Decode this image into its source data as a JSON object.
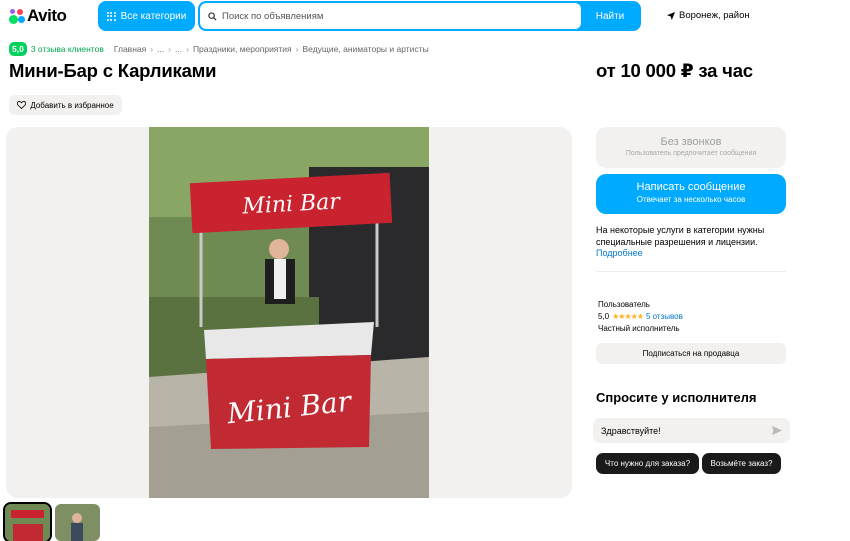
{
  "header": {
    "logo_text": "Avito",
    "categories_label": "Все категории",
    "search_placeholder": "Поиск по объявлениям",
    "search_button": "Найти",
    "location": "Воронеж, район"
  },
  "rating": {
    "score": "5,0",
    "reviews": "3 отзыва клиентов"
  },
  "breadcrumbs": [
    "Главная",
    "...",
    "...",
    "Праздники, мероприятия",
    "Ведущие, аниматоры и артисты"
  ],
  "listing": {
    "title": "Мини-Бар с Карликами",
    "price": "от 10 000 ₽ за час",
    "favorite_label": "Добавить в избранное"
  },
  "photo": {
    "sign_text": "Mini Bar"
  },
  "contact": {
    "no_calls_title": "Без звонков",
    "no_calls_sub": "Пользователь предпочитает сообщения",
    "message_title": "Написать сообщение",
    "message_sub": "Отвечает за несколько часов"
  },
  "notice": {
    "text": "На некоторые услуги в категории нужны специальные разрешения и лицензии.",
    "link": "Подробнее"
  },
  "seller": {
    "label": "Пользователь",
    "score": "5,0",
    "stars": "★★★★★",
    "reviews": "5 отзывов",
    "type": "Частный исполнитель",
    "subscribe": "Подписаться на продавца"
  },
  "ask": {
    "title": "Спросите у исполнителя",
    "input_value": "Здравствуйте!",
    "chips": [
      "Что нужно для заказа?",
      "Возьмёте заказ?"
    ]
  },
  "colors": {
    "brand_blue": "#00aaff",
    "rating_green": "#02d15c",
    "star_yellow": "#ffb021",
    "link_blue": "#0077cc"
  }
}
